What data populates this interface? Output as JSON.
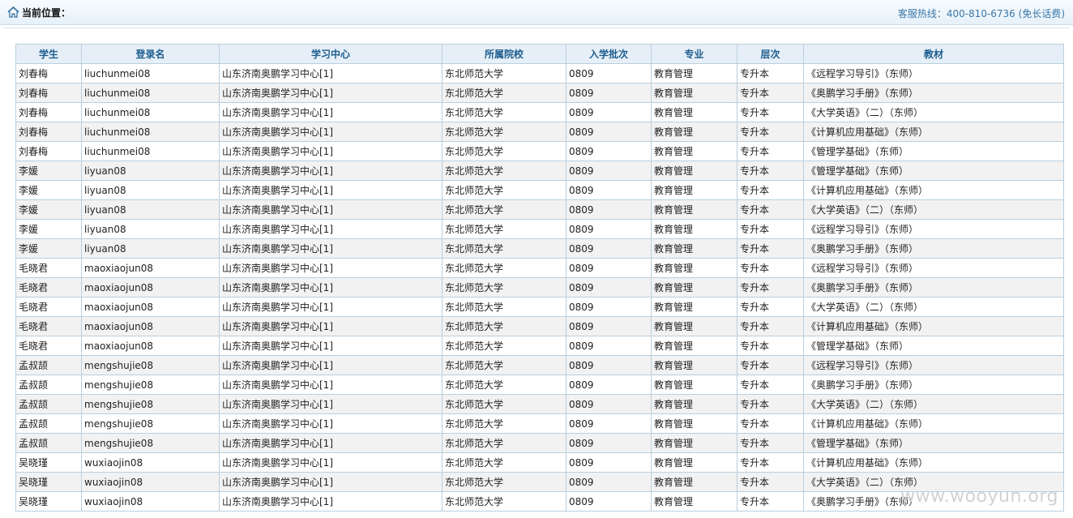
{
  "header": {
    "location_label": "当前位置：",
    "hotline": "客服热线：400-810-6736 (免长话费)"
  },
  "table": {
    "columns": [
      "学生",
      "登录名",
      "学习中心",
      "所属院校",
      "入学批次",
      "专业",
      "层次",
      "教材"
    ],
    "rows": [
      [
        "刘春梅",
        "liuchunmei08",
        "山东济南奥鹏学习中心[1]",
        "东北师范大学",
        "0809",
        "教育管理",
        "专升本",
        "《远程学习导引》（东师）"
      ],
      [
        "刘春梅",
        "liuchunmei08",
        "山东济南奥鹏学习中心[1]",
        "东北师范大学",
        "0809",
        "教育管理",
        "专升本",
        "《奥鹏学习手册》（东师）"
      ],
      [
        "刘春梅",
        "liuchunmei08",
        "山东济南奥鹏学习中心[1]",
        "东北师范大学",
        "0809",
        "教育管理",
        "专升本",
        "《大学英语》（二）（东师）"
      ],
      [
        "刘春梅",
        "liuchunmei08",
        "山东济南奥鹏学习中心[1]",
        "东北师范大学",
        "0809",
        "教育管理",
        "专升本",
        "《计算机应用基础》（东师）"
      ],
      [
        "刘春梅",
        "liuchunmei08",
        "山东济南奥鹏学习中心[1]",
        "东北师范大学",
        "0809",
        "教育管理",
        "专升本",
        "《管理学基础》（东师）"
      ],
      [
        "李媛",
        "liyuan08",
        "山东济南奥鹏学习中心[1]",
        "东北师范大学",
        "0809",
        "教育管理",
        "专升本",
        "《管理学基础》（东师）"
      ],
      [
        "李媛",
        "liyuan08",
        "山东济南奥鹏学习中心[1]",
        "东北师范大学",
        "0809",
        "教育管理",
        "专升本",
        "《计算机应用基础》（东师）"
      ],
      [
        "李媛",
        "liyuan08",
        "山东济南奥鹏学习中心[1]",
        "东北师范大学",
        "0809",
        "教育管理",
        "专升本",
        "《大学英语》（二）（东师）"
      ],
      [
        "李媛",
        "liyuan08",
        "山东济南奥鹏学习中心[1]",
        "东北师范大学",
        "0809",
        "教育管理",
        "专升本",
        "《远程学习导引》（东师）"
      ],
      [
        "李媛",
        "liyuan08",
        "山东济南奥鹏学习中心[1]",
        "东北师范大学",
        "0809",
        "教育管理",
        "专升本",
        "《奥鹏学习手册》（东师）"
      ],
      [
        "毛晓君",
        "maoxiaojun08",
        "山东济南奥鹏学习中心[1]",
        "东北师范大学",
        "0809",
        "教育管理",
        "专升本",
        "《远程学习导引》（东师）"
      ],
      [
        "毛晓君",
        "maoxiaojun08",
        "山东济南奥鹏学习中心[1]",
        "东北师范大学",
        "0809",
        "教育管理",
        "专升本",
        "《奥鹏学习手册》（东师）"
      ],
      [
        "毛晓君",
        "maoxiaojun08",
        "山东济南奥鹏学习中心[1]",
        "东北师范大学",
        "0809",
        "教育管理",
        "专升本",
        "《大学英语》（二）（东师）"
      ],
      [
        "毛晓君",
        "maoxiaojun08",
        "山东济南奥鹏学习中心[1]",
        "东北师范大学",
        "0809",
        "教育管理",
        "专升本",
        "《计算机应用基础》（东师）"
      ],
      [
        "毛晓君",
        "maoxiaojun08",
        "山东济南奥鹏学习中心[1]",
        "东北师范大学",
        "0809",
        "教育管理",
        "专升本",
        "《管理学基础》（东师）"
      ],
      [
        "孟叔颉",
        "mengshujie08",
        "山东济南奥鹏学习中心[1]",
        "东北师范大学",
        "0809",
        "教育管理",
        "专升本",
        "《远程学习导引》（东师）"
      ],
      [
        "孟叔颉",
        "mengshujie08",
        "山东济南奥鹏学习中心[1]",
        "东北师范大学",
        "0809",
        "教育管理",
        "专升本",
        "《奥鹏学习手册》（东师）"
      ],
      [
        "孟叔颉",
        "mengshujie08",
        "山东济南奥鹏学习中心[1]",
        "东北师范大学",
        "0809",
        "教育管理",
        "专升本",
        "《大学英语》（二）（东师）"
      ],
      [
        "孟叔颉",
        "mengshujie08",
        "山东济南奥鹏学习中心[1]",
        "东北师范大学",
        "0809",
        "教育管理",
        "专升本",
        "《计算机应用基础》（东师）"
      ],
      [
        "孟叔颉",
        "mengshujie08",
        "山东济南奥鹏学习中心[1]",
        "东北师范大学",
        "0809",
        "教育管理",
        "专升本",
        "《管理学基础》（东师）"
      ],
      [
        "吴晓瑾",
        "wuxiaojin08",
        "山东济南奥鹏学习中心[1]",
        "东北师范大学",
        "0809",
        "教育管理",
        "专升本",
        "《计算机应用基础》（东师）"
      ],
      [
        "吴晓瑾",
        "wuxiaojin08",
        "山东济南奥鹏学习中心[1]",
        "东北师范大学",
        "0809",
        "教育管理",
        "专升本",
        "《大学英语》（二）（东师）"
      ],
      [
        "吴晓瑾",
        "wuxiaojin08",
        "山东济南奥鹏学习中心[1]",
        "东北师范大学",
        "0809",
        "教育管理",
        "专升本",
        "《奥鹏学习手册》（东师）"
      ]
    ]
  },
  "watermark": "www.wooyun.org"
}
